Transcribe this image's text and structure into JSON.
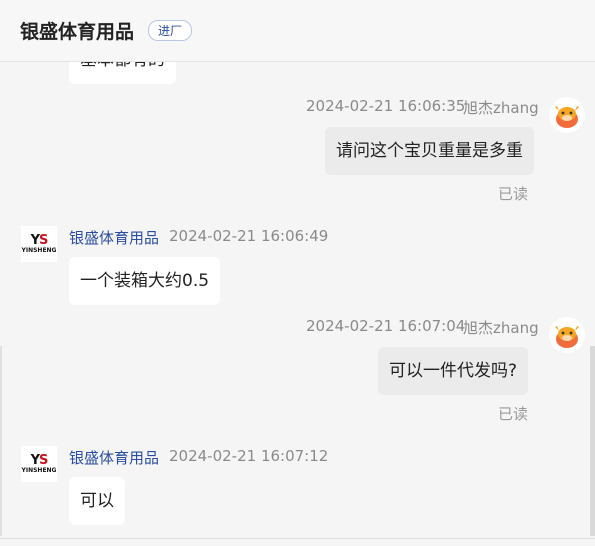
{
  "header": {
    "shop_name": "银盛体育用品",
    "tag": "进厂"
  },
  "messages": [
    {
      "id": "m0",
      "direction": "in",
      "text": "基本都有的"
    },
    {
      "id": "m1",
      "direction": "out",
      "time": "2024-02-21 16:06:35",
      "sender": "旭杰zhang",
      "text": "请问这个宝贝重量是多重",
      "status": "已读"
    },
    {
      "id": "m2",
      "direction": "in",
      "sender": "银盛体育用品",
      "time": "2024-02-21 16:06:49",
      "text": "一个装箱大约0.5"
    },
    {
      "id": "m3",
      "direction": "out",
      "time": "2024-02-21 16:07:04",
      "sender": "旭杰zhang",
      "text": "可以一件代发吗?",
      "status": "已读"
    },
    {
      "id": "m4",
      "direction": "in",
      "sender": "银盛体育用品",
      "time": "2024-02-21 16:07:12",
      "text": "可以"
    }
  ],
  "shop_avatar": {
    "logo_text_1": "Y",
    "logo_text_2": "S",
    "logo_sub": "YINSHENG"
  },
  "icons": {
    "user_avatar": "cartoon-cow-avatar-icon",
    "shop_avatar": "ys-logo-icon"
  },
  "colors": {
    "shop_name": "#2b4ea3",
    "out_bubble": "#ebebeb",
    "in_bubble": "#ffffff",
    "avatar_orange": "#f26b3a"
  }
}
